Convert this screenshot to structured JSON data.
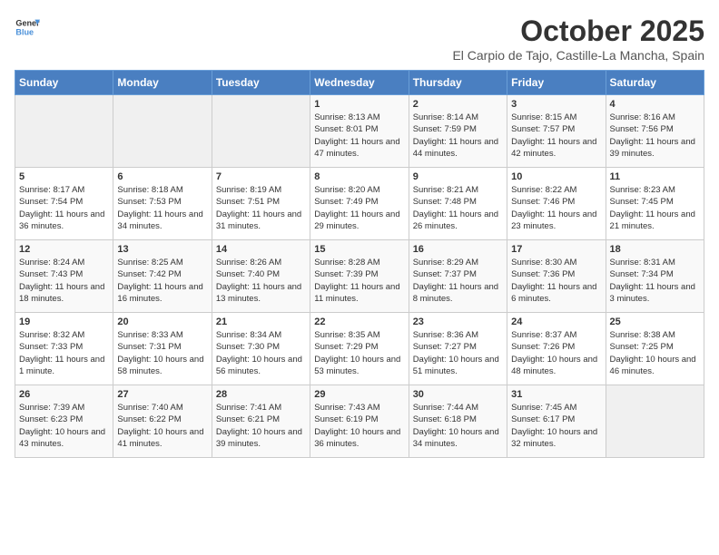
{
  "logo": {
    "line1": "General",
    "line2": "Blue"
  },
  "title": "October 2025",
  "subtitle": "El Carpio de Tajo, Castille-La Mancha, Spain",
  "days_of_week": [
    "Sunday",
    "Monday",
    "Tuesday",
    "Wednesday",
    "Thursday",
    "Friday",
    "Saturday"
  ],
  "weeks": [
    [
      {
        "day": "",
        "info": ""
      },
      {
        "day": "",
        "info": ""
      },
      {
        "day": "",
        "info": ""
      },
      {
        "day": "1",
        "info": "Sunrise: 8:13 AM\nSunset: 8:01 PM\nDaylight: 11 hours and 47 minutes."
      },
      {
        "day": "2",
        "info": "Sunrise: 8:14 AM\nSunset: 7:59 PM\nDaylight: 11 hours and 44 minutes."
      },
      {
        "day": "3",
        "info": "Sunrise: 8:15 AM\nSunset: 7:57 PM\nDaylight: 11 hours and 42 minutes."
      },
      {
        "day": "4",
        "info": "Sunrise: 8:16 AM\nSunset: 7:56 PM\nDaylight: 11 hours and 39 minutes."
      }
    ],
    [
      {
        "day": "5",
        "info": "Sunrise: 8:17 AM\nSunset: 7:54 PM\nDaylight: 11 hours and 36 minutes."
      },
      {
        "day": "6",
        "info": "Sunrise: 8:18 AM\nSunset: 7:53 PM\nDaylight: 11 hours and 34 minutes."
      },
      {
        "day": "7",
        "info": "Sunrise: 8:19 AM\nSunset: 7:51 PM\nDaylight: 11 hours and 31 minutes."
      },
      {
        "day": "8",
        "info": "Sunrise: 8:20 AM\nSunset: 7:49 PM\nDaylight: 11 hours and 29 minutes."
      },
      {
        "day": "9",
        "info": "Sunrise: 8:21 AM\nSunset: 7:48 PM\nDaylight: 11 hours and 26 minutes."
      },
      {
        "day": "10",
        "info": "Sunrise: 8:22 AM\nSunset: 7:46 PM\nDaylight: 11 hours and 23 minutes."
      },
      {
        "day": "11",
        "info": "Sunrise: 8:23 AM\nSunset: 7:45 PM\nDaylight: 11 hours and 21 minutes."
      }
    ],
    [
      {
        "day": "12",
        "info": "Sunrise: 8:24 AM\nSunset: 7:43 PM\nDaylight: 11 hours and 18 minutes."
      },
      {
        "day": "13",
        "info": "Sunrise: 8:25 AM\nSunset: 7:42 PM\nDaylight: 11 hours and 16 minutes."
      },
      {
        "day": "14",
        "info": "Sunrise: 8:26 AM\nSunset: 7:40 PM\nDaylight: 11 hours and 13 minutes."
      },
      {
        "day": "15",
        "info": "Sunrise: 8:28 AM\nSunset: 7:39 PM\nDaylight: 11 hours and 11 minutes."
      },
      {
        "day": "16",
        "info": "Sunrise: 8:29 AM\nSunset: 7:37 PM\nDaylight: 11 hours and 8 minutes."
      },
      {
        "day": "17",
        "info": "Sunrise: 8:30 AM\nSunset: 7:36 PM\nDaylight: 11 hours and 6 minutes."
      },
      {
        "day": "18",
        "info": "Sunrise: 8:31 AM\nSunset: 7:34 PM\nDaylight: 11 hours and 3 minutes."
      }
    ],
    [
      {
        "day": "19",
        "info": "Sunrise: 8:32 AM\nSunset: 7:33 PM\nDaylight: 11 hours and 1 minute."
      },
      {
        "day": "20",
        "info": "Sunrise: 8:33 AM\nSunset: 7:31 PM\nDaylight: 10 hours and 58 minutes."
      },
      {
        "day": "21",
        "info": "Sunrise: 8:34 AM\nSunset: 7:30 PM\nDaylight: 10 hours and 56 minutes."
      },
      {
        "day": "22",
        "info": "Sunrise: 8:35 AM\nSunset: 7:29 PM\nDaylight: 10 hours and 53 minutes."
      },
      {
        "day": "23",
        "info": "Sunrise: 8:36 AM\nSunset: 7:27 PM\nDaylight: 10 hours and 51 minutes."
      },
      {
        "day": "24",
        "info": "Sunrise: 8:37 AM\nSunset: 7:26 PM\nDaylight: 10 hours and 48 minutes."
      },
      {
        "day": "25",
        "info": "Sunrise: 8:38 AM\nSunset: 7:25 PM\nDaylight: 10 hours and 46 minutes."
      }
    ],
    [
      {
        "day": "26",
        "info": "Sunrise: 7:39 AM\nSunset: 6:23 PM\nDaylight: 10 hours and 43 minutes."
      },
      {
        "day": "27",
        "info": "Sunrise: 7:40 AM\nSunset: 6:22 PM\nDaylight: 10 hours and 41 minutes."
      },
      {
        "day": "28",
        "info": "Sunrise: 7:41 AM\nSunset: 6:21 PM\nDaylight: 10 hours and 39 minutes."
      },
      {
        "day": "29",
        "info": "Sunrise: 7:43 AM\nSunset: 6:19 PM\nDaylight: 10 hours and 36 minutes."
      },
      {
        "day": "30",
        "info": "Sunrise: 7:44 AM\nSunset: 6:18 PM\nDaylight: 10 hours and 34 minutes."
      },
      {
        "day": "31",
        "info": "Sunrise: 7:45 AM\nSunset: 6:17 PM\nDaylight: 10 hours and 32 minutes."
      },
      {
        "day": "",
        "info": ""
      }
    ]
  ]
}
